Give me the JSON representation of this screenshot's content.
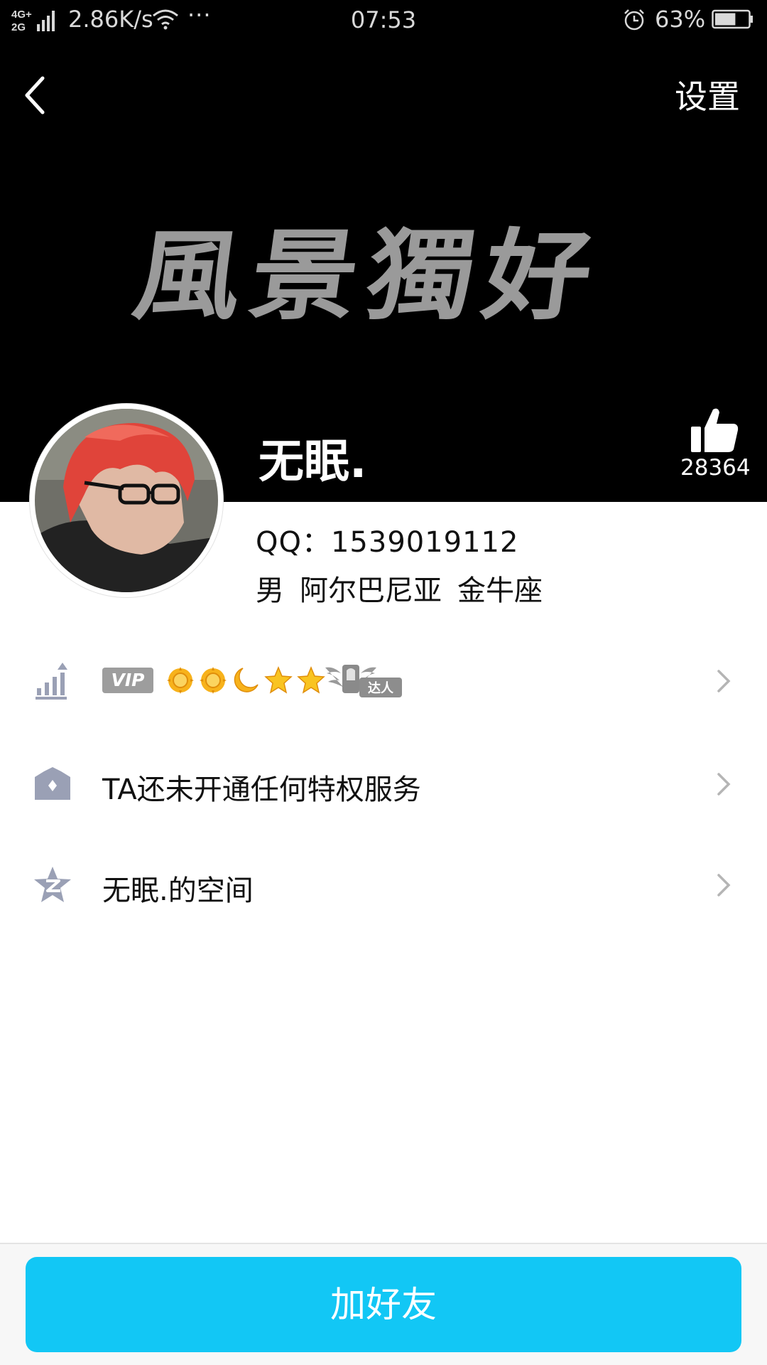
{
  "status_bar": {
    "network": "4G‡\n2G",
    "speed": "2.86K/s",
    "dots": "···",
    "time": "07:53",
    "battery": "63%"
  },
  "header": {
    "settings_label": "设置"
  },
  "cover": {
    "calligraphy": [
      "風",
      "景",
      "獨",
      "好"
    ]
  },
  "profile": {
    "nickname": "无眠.",
    "likes": "28364",
    "qq_line": "QQ：1539019112",
    "gender": "男",
    "region": "阿尔巴尼亚",
    "constellation": "金牛座"
  },
  "level_row": {
    "vip_label": "VIP",
    "level_icons": [
      "sun-icon",
      "sun-icon",
      "moon-icon",
      "star-icon",
      "star-icon"
    ],
    "badge_label": "达人"
  },
  "privilege_row": {
    "label": "TA还未开通任何特权服务"
  },
  "space_row": {
    "label": "无眠.的空间"
  },
  "actions": {
    "add_friend_label": "加好友"
  },
  "colors": {
    "accent": "#12c7f5",
    "row_icon": "#9aa0b5",
    "chevron": "#b5b5b5",
    "sun": "#f7b21b",
    "header_bg": "#000000"
  }
}
